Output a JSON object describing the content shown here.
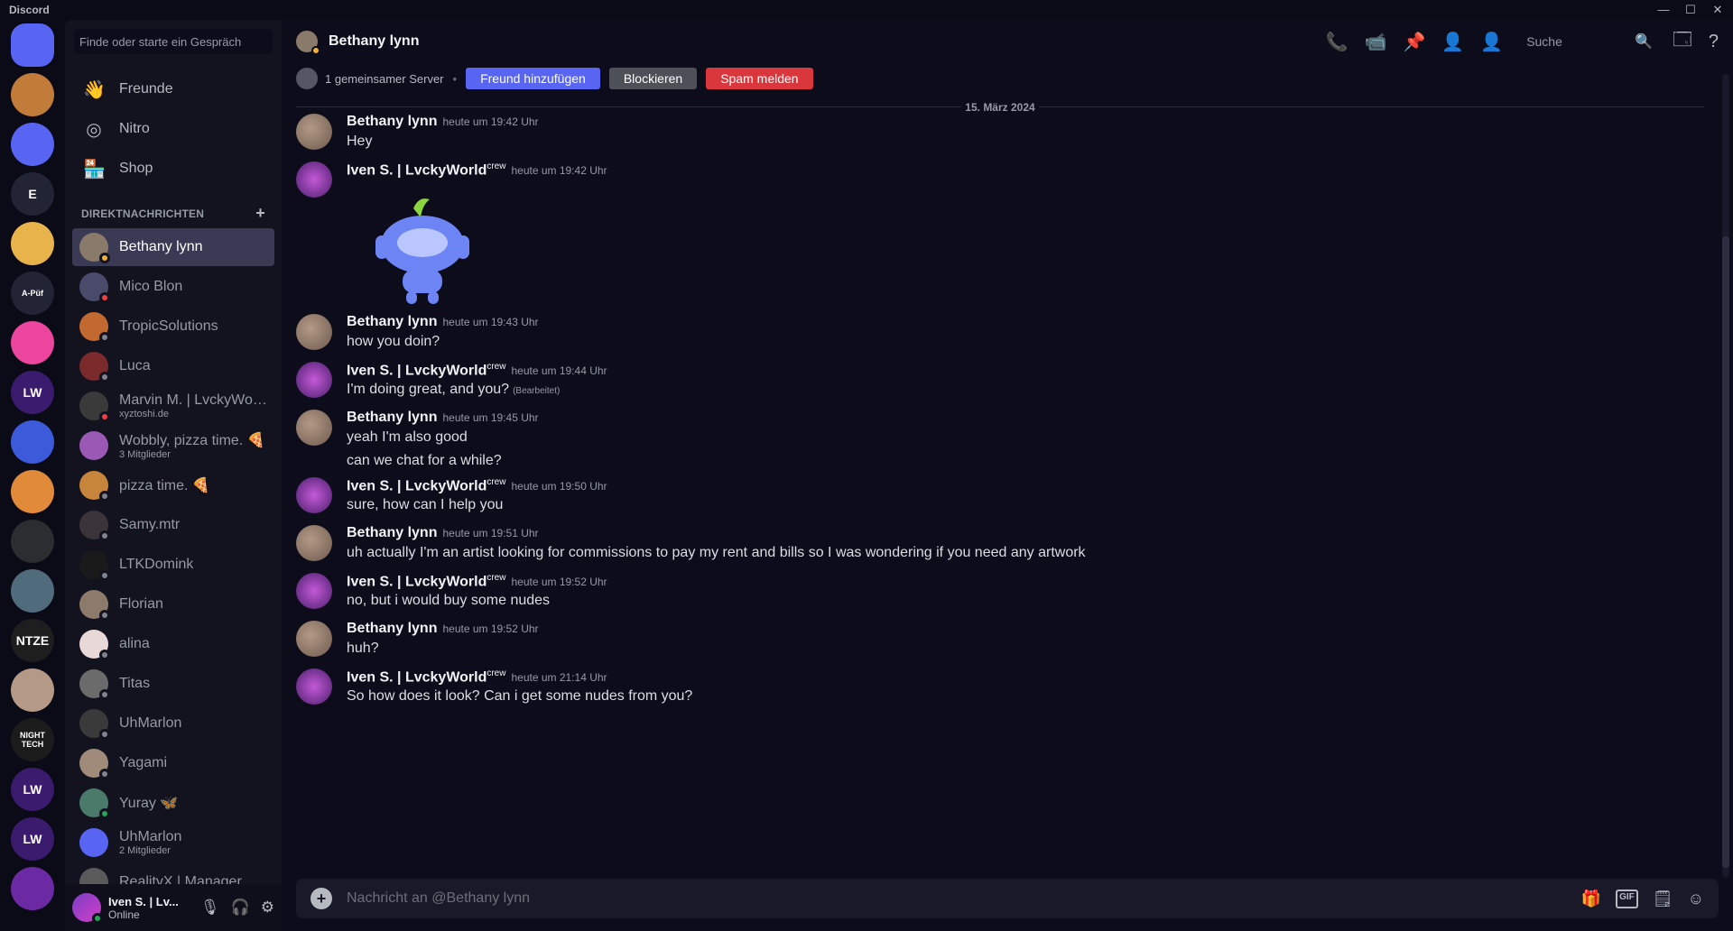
{
  "window": {
    "title": "Discord",
    "controls": [
      "—",
      "☐",
      "✕"
    ]
  },
  "rail": {
    "servers": [
      {
        "label": "",
        "color": "#5865f2",
        "kind": "home"
      },
      {
        "label": "",
        "color": "#c27c3a"
      },
      {
        "label": "",
        "color": "#5865f2"
      },
      {
        "label": "E",
        "color": "#232336"
      },
      {
        "label": "",
        "color": "#e8b34a"
      },
      {
        "label": "A-Püf",
        "color": "#232336"
      },
      {
        "label": "",
        "color": "#eb459e"
      },
      {
        "label": "LW",
        "color": "#3b1b6d"
      },
      {
        "label": "",
        "color": "#3b5bdb"
      },
      {
        "label": "",
        "color": "#e08a3a"
      },
      {
        "label": "",
        "color": "#2b2d31"
      },
      {
        "label": "",
        "color": "#4f6b7c"
      },
      {
        "label": "NTZE",
        "color": "#1e1e1e"
      },
      {
        "label": "",
        "color": "#b59987"
      },
      {
        "label": "NIGHT TECH",
        "color": "#1b1b1b"
      },
      {
        "label": "LW",
        "color": "#3b1b6d"
      },
      {
        "label": "LW",
        "color": "#3b1b6d"
      },
      {
        "label": "",
        "color": "#6b2aa3"
      }
    ]
  },
  "sidebar": {
    "search_placeholder": "Finde oder starte ein Gespräch",
    "nav": [
      {
        "label": "Freunde",
        "icon": "friends-icon",
        "glyph": "👋"
      },
      {
        "label": "Nitro",
        "icon": "nitro-icon",
        "glyph": "◎"
      },
      {
        "label": "Shop",
        "icon": "shop-icon",
        "glyph": "🏪"
      }
    ],
    "dm_header": "DIREKTNACHRICHTEN",
    "dm_add": "+",
    "dms": [
      {
        "name": "Bethany lynn",
        "sub": "",
        "color": "#8a7a6a",
        "status": "#f0b232",
        "active": true
      },
      {
        "name": "Mico Blon",
        "sub": "",
        "color": "#4a4a6a",
        "status": "#f23f43"
      },
      {
        "name": "TropicSolutions",
        "sub": "",
        "color": "#c2692f",
        "status": "#80848e"
      },
      {
        "name": "Luca",
        "sub": "",
        "color": "#7a2a2a",
        "status": "#80848e"
      },
      {
        "name": "Marvin M. | LvckyWorl...",
        "sub": "xyztoshi.de",
        "color": "#3a3a3a",
        "status": "#f23f43"
      },
      {
        "name": "Wobbly, pizza time. 🍕",
        "sub": "3 Mitglieder",
        "color": "#9b59b6",
        "status": ""
      },
      {
        "name": "pizza time. 🍕",
        "sub": "",
        "color": "#c6853a",
        "status": "#80848e"
      },
      {
        "name": "Samy.mtr",
        "sub": "",
        "color": "#3a3438",
        "status": "#80848e"
      },
      {
        "name": "LTKDomink",
        "sub": "",
        "color": "#1a1a1a",
        "status": "#80848e"
      },
      {
        "name": "Florian",
        "sub": "",
        "color": "#8c7a6b",
        "status": "#80848e"
      },
      {
        "name": "alina",
        "sub": "",
        "color": "#e8d8d8",
        "status": "#80848e"
      },
      {
        "name": "Titas",
        "sub": "",
        "color": "#6b6b6b",
        "status": "#80848e"
      },
      {
        "name": "UhMarlon",
        "sub": "",
        "color": "#3a3a3a",
        "status": "#80848e"
      },
      {
        "name": "Yagami",
        "sub": "",
        "color": "#a08a7a",
        "status": "#80848e"
      },
      {
        "name": "Yuray 🦋",
        "sub": "",
        "color": "#4a7a6a",
        "status": "#23a55a"
      },
      {
        "name": "UhMarlon",
        "sub": "2 Mitglieder",
        "color": "#5865f2",
        "status": ""
      },
      {
        "name": "RealityX | Manager",
        "sub": "",
        "color": "#5a5a5a",
        "status": ""
      }
    ]
  },
  "user_panel": {
    "name": "Iven S. | Lv...",
    "status": "Online"
  },
  "header": {
    "title": "Bethany lynn",
    "search_placeholder": "Suche",
    "mutual": "1 gemeinsamer Server",
    "add_friend": "Freund hinzufügen",
    "block": "Blockieren",
    "report": "Spam melden"
  },
  "date_divider": "15. März 2024",
  "messages": [
    {
      "author": "Bethany lynn",
      "tag": "",
      "time": "heute um 19:42 Uhr",
      "lines": [
        "Hey"
      ],
      "avatar": "beth",
      "edited": ""
    },
    {
      "author": "Iven S. | LvckyWorld",
      "tag": "crew",
      "time": "heute um 19:42 Uhr",
      "lines": [],
      "avatar": "iven",
      "sticker": true,
      "edited": ""
    },
    {
      "author": "Bethany lynn",
      "tag": "",
      "time": "heute um 19:43 Uhr",
      "lines": [
        "how you doin?"
      ],
      "avatar": "beth",
      "edited": ""
    },
    {
      "author": "Iven S. | LvckyWorld",
      "tag": "crew",
      "time": "heute um 19:44 Uhr",
      "lines": [
        "I'm doing great, and you?"
      ],
      "avatar": "iven",
      "edited": "(Bearbeitet)"
    },
    {
      "author": "Bethany lynn",
      "tag": "",
      "time": "heute um 19:45 Uhr",
      "lines": [
        "yeah I'm also good",
        "can we chat for a while?"
      ],
      "avatar": "beth",
      "edited": ""
    },
    {
      "author": "Iven S. | LvckyWorld",
      "tag": "crew",
      "time": "heute um 19:50 Uhr",
      "lines": [
        "sure, how can I help you"
      ],
      "avatar": "iven",
      "edited": ""
    },
    {
      "author": "Bethany lynn",
      "tag": "",
      "time": "heute um 19:51 Uhr",
      "lines": [
        "uh actually I'm an artist looking for commissions to pay my rent and bills so I was wondering if you need any artwork"
      ],
      "avatar": "beth",
      "edited": ""
    },
    {
      "author": "Iven S. | LvckyWorld",
      "tag": "crew",
      "time": "heute um 19:52 Uhr",
      "lines": [
        "no, but i would buy some nudes"
      ],
      "avatar": "iven",
      "edited": ""
    },
    {
      "author": "Bethany lynn",
      "tag": "",
      "time": "heute um 19:52 Uhr",
      "lines": [
        "huh?"
      ],
      "avatar": "beth",
      "edited": ""
    },
    {
      "author": "Iven S. | LvckyWorld",
      "tag": "crew",
      "time": "heute um 21:14 Uhr",
      "lines": [
        "So how does it look? Can i get some nudes from you?"
      ],
      "avatar": "iven",
      "edited": ""
    }
  ],
  "composer": {
    "placeholder": "Nachricht an @Bethany lynn"
  },
  "colors": {
    "accent": "#5865f2",
    "danger": "#da373c",
    "background": "#0d0c1b"
  }
}
